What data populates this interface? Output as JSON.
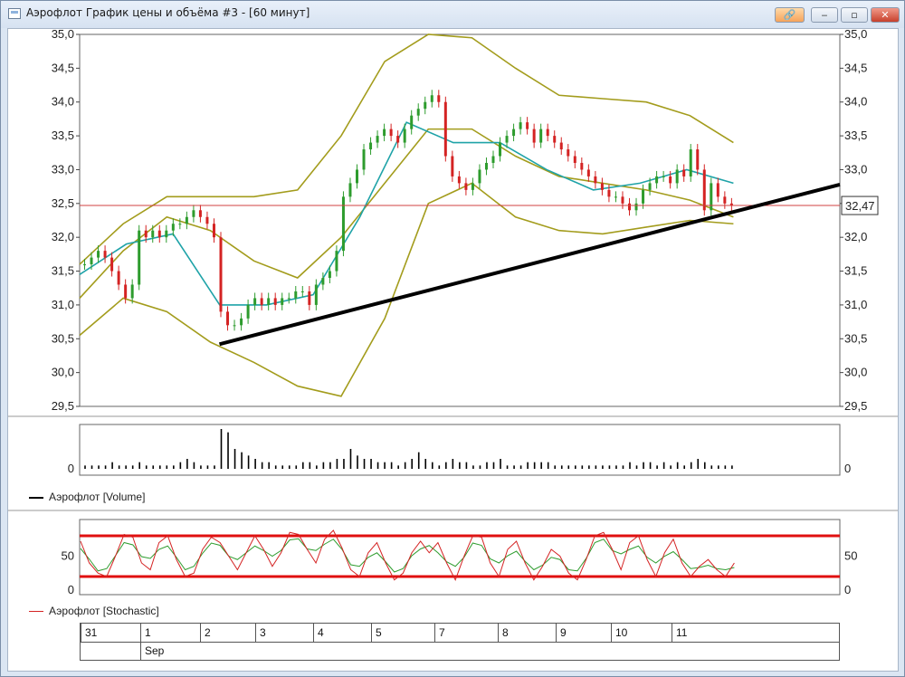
{
  "window": {
    "title": "Аэрофлот График цены и объёма #3 - [60 минут]",
    "buttons": {
      "link": "🔗",
      "minimize": "‒",
      "restore": "▫",
      "close": "✕"
    }
  },
  "price_panel": {
    "y_ticks": [
      "35,0",
      "34,5",
      "34,0",
      "33,5",
      "33,0",
      "32,5",
      "32,0",
      "31,5",
      "31,0",
      "30,5",
      "30,0",
      "29,5"
    ],
    "last_price_label": "32,47",
    "colors": {
      "up": "#2e9c2e",
      "down": "#d42323",
      "ma": "#1fa3a8",
      "bands": "#a39c1c",
      "level": "#d04040",
      "trendline": "#000000"
    }
  },
  "volume_panel": {
    "y_ticks": [
      "0"
    ],
    "legend": "Аэрофлот [Volume]"
  },
  "stochastic_panel": {
    "y_ticks": [
      "50",
      "0"
    ],
    "legend": "Аэрофлот [Stochastic]",
    "levels": [
      80,
      20
    ],
    "colors": {
      "k": "#d42323",
      "d": "#2e9c2e",
      "level": "#e01010"
    }
  },
  "date_axis": {
    "days": [
      "31",
      "1",
      "2",
      "3",
      "4",
      "5",
      "7",
      "8",
      "9",
      "10",
      "11"
    ],
    "months": [
      "Sep"
    ]
  },
  "chart_data": {
    "type": "candlestick",
    "title": "Аэрофлот График цены и объёма #3 - [60 минут]",
    "ylim": [
      29.5,
      35.0
    ],
    "last_price": 32.47,
    "horizontal_level": 32.47,
    "trendline": {
      "start": {
        "day": "1",
        "price": 30.42
      },
      "end": {
        "day": "right edge",
        "price": 32.78
      }
    },
    "closes": [
      31.6,
      31.7,
      31.8,
      31.7,
      31.5,
      31.3,
      31.1,
      31.3,
      32.1,
      32.0,
      32.1,
      32.0,
      32.1,
      32.2,
      32.2,
      32.3,
      32.4,
      32.3,
      32.2,
      32.0,
      30.9,
      30.7,
      30.7,
      30.8,
      31.0,
      31.1,
      31.0,
      31.1,
      31.0,
      31.1,
      31.1,
      31.2,
      31.2,
      31.0,
      31.3,
      31.4,
      31.5,
      31.8,
      32.6,
      32.8,
      33.0,
      33.3,
      33.4,
      33.5,
      33.6,
      33.5,
      33.4,
      33.6,
      33.8,
      33.9,
      34.0,
      34.1,
      34.0,
      33.2,
      32.9,
      32.8,
      32.7,
      32.8,
      33.0,
      33.1,
      33.2,
      33.4,
      33.5,
      33.6,
      33.7,
      33.6,
      33.4,
      33.6,
      33.5,
      33.4,
      33.3,
      33.2,
      33.1,
      33.0,
      32.9,
      32.8,
      32.7,
      32.6,
      32.6,
      32.5,
      32.4,
      32.5,
      32.7,
      32.8,
      32.9,
      32.9,
      32.8,
      33.0,
      32.9,
      33.3,
      33.0,
      32.4,
      32.8,
      32.6,
      32.5,
      32.47
    ],
    "bollinger": {
      "upper": [
        31.6,
        32.2,
        32.6,
        32.6,
        32.6,
        32.7,
        33.5,
        34.6,
        35.0,
        34.95,
        34.5,
        34.1,
        34.05,
        34.0,
        33.8,
        33.4
      ],
      "middle": [
        31.1,
        31.8,
        32.3,
        32.1,
        31.65,
        31.4,
        32.0,
        32.8,
        33.6,
        33.6,
        33.2,
        32.9,
        32.8,
        32.7,
        32.55,
        32.3
      ],
      "lower": [
        30.55,
        31.1,
        30.9,
        30.45,
        30.15,
        29.8,
        29.65,
        30.8,
        32.5,
        32.8,
        32.3,
        32.1,
        32.05,
        32.15,
        32.25,
        32.2
      ],
      "ma": [
        31.45,
        31.9,
        32.05,
        31.0,
        31.0,
        31.15,
        32.3,
        33.7,
        33.4,
        33.4,
        33.0,
        32.7,
        32.8,
        33.0,
        32.8
      ]
    },
    "volume": [
      1,
      1,
      1,
      1,
      2,
      1,
      1,
      1,
      2,
      1,
      1,
      1,
      1,
      1,
      2,
      3,
      2,
      1,
      1,
      1,
      12,
      11,
      6,
      5,
      4,
      3,
      2,
      2,
      1,
      1,
      1,
      1,
      2,
      2,
      1,
      2,
      2,
      3,
      3,
      6,
      4,
      3,
      3,
      2,
      2,
      2,
      1,
      2,
      3,
      5,
      3,
      2,
      1,
      2,
      3,
      2,
      2,
      1,
      1,
      2,
      2,
      3,
      1,
      1,
      1,
      2,
      2,
      2,
      2,
      1,
      1,
      1,
      1,
      1,
      1,
      1,
      1,
      1,
      1,
      1,
      2,
      1,
      2,
      2,
      1,
      2,
      1,
      2,
      1,
      2,
      3,
      2,
      1,
      1,
      1,
      1
    ],
    "stochastic": {
      "k": [
        72,
        40,
        25,
        20,
        50,
        82,
        78,
        40,
        30,
        70,
        80,
        45,
        20,
        25,
        60,
        78,
        70,
        50,
        30,
        55,
        80,
        60,
        35,
        55,
        85,
        82,
        60,
        40,
        75,
        88,
        62,
        30,
        20,
        55,
        70,
        40,
        15,
        25,
        55,
        72,
        55,
        70,
        40,
        15,
        50,
        80,
        78,
        40,
        20,
        60,
        72,
        40,
        15,
        35,
        60,
        50,
        25,
        15,
        45,
        80,
        85,
        60,
        30,
        70,
        80,
        45,
        20,
        55,
        75,
        40,
        20,
        35,
        45,
        30,
        20,
        40
      ]
    }
  }
}
